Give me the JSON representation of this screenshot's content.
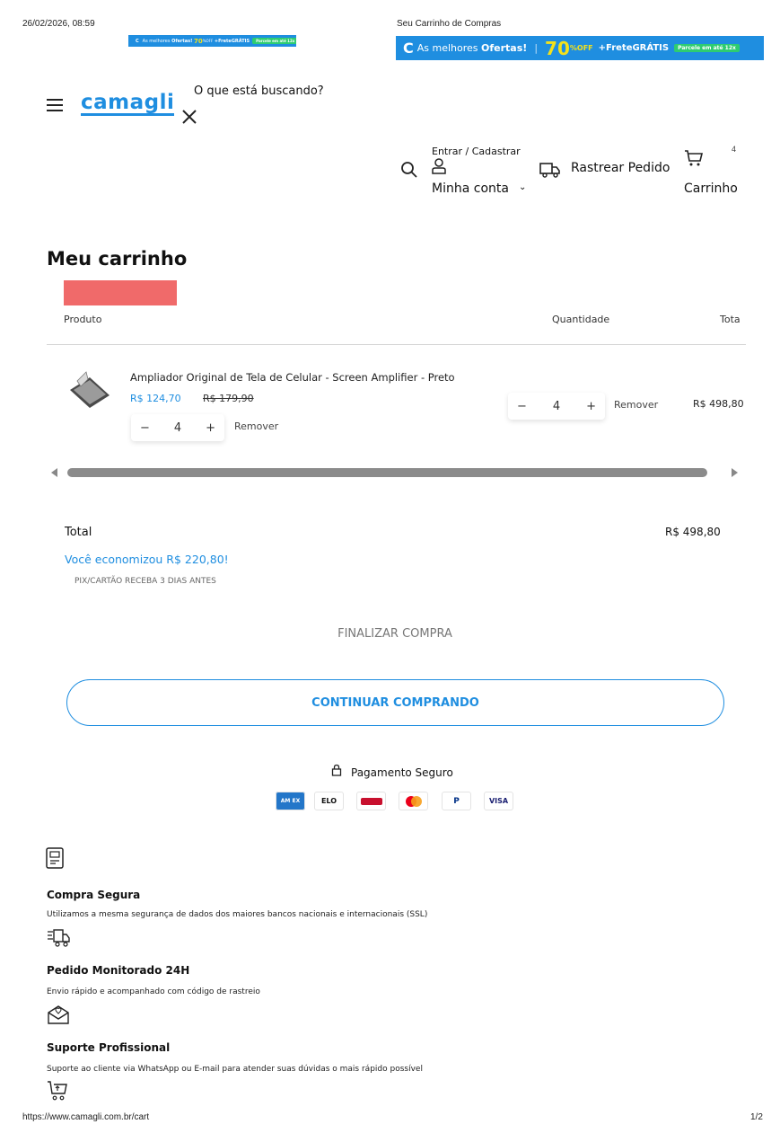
{
  "print_header": {
    "datetime": "26/02/2026, 08:59",
    "doc_title": "Seu Carrinho de Compras",
    "url": "https://www.camagli.com.br/cart",
    "page_number": "1/2"
  },
  "promo_banner": {
    "prefix": "As melhores",
    "highlight": "Ofertas!",
    "discount": "70",
    "discount_suffix": "%OFF",
    "shipping": "+FreteGRÁTIS",
    "pill": "Parcele em até 12x"
  },
  "header": {
    "logo": "camagli",
    "search_placeholder": "O que está buscando?",
    "login_label": "Entrar / Cadastrar",
    "account_label": "Minha conta",
    "track_label": "Rastrear Pedido",
    "cart_label": "Carrinho",
    "cart_count": "4"
  },
  "cart": {
    "title": "Meu carrinho",
    "columns": {
      "product": "Produto",
      "quantity": "Quantidade",
      "total": "Tota"
    },
    "item": {
      "name": "Ampliador Original de Tela de Celular - Screen Amplifier - Preto",
      "price": "R$ 124,70",
      "old_price": "R$ 179,90",
      "quantity": "4",
      "remove_label": "Remover",
      "line_total": "R$ 498,80"
    }
  },
  "summary": {
    "total_label": "Total",
    "total_value": "R$ 498,80",
    "savings": "Você economizou R$ 220,80!",
    "pix_note": "PIX/CARTÃO RECEBA 3 DIAS ANTES",
    "checkout_label": "FINALIZAR COMPRA",
    "continue_label": "CONTINUAR COMPRANDO"
  },
  "payment": {
    "secure_label": "Pagamento Seguro",
    "methods": [
      "AM EX",
      "ELO",
      "Hipercard",
      "Mastercard",
      "PayPal",
      "VISA"
    ]
  },
  "features": [
    {
      "title": "Compra Segura",
      "desc": "Utilizamos a mesma segurança de dados dos maiores bancos nacionais e internacionais (SSL)"
    },
    {
      "title": "Pedido Monitorado 24H",
      "desc": "Envio rápido e acompanhado com código de rastreio"
    },
    {
      "title": "Suporte Profissional",
      "desc": "Suporte ao cliente via WhatsApp ou E-mail para atender suas dúvidas o mais rápido possível"
    }
  ],
  "colors": {
    "accent": "#1f8ee0",
    "banner": "#1f8ee0",
    "highlight_red": "#f06a6a"
  }
}
